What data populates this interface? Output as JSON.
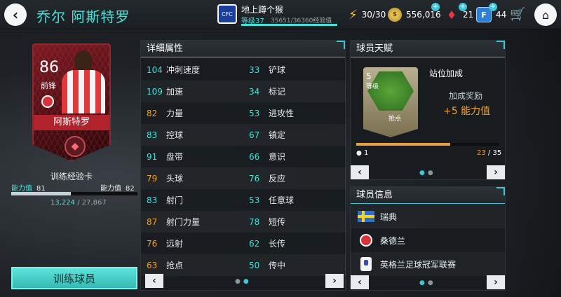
{
  "header": {
    "title": "乔尔 阿斯特罗",
    "team": {
      "name": "地上蹲个猴",
      "level": "等级37",
      "xp": "35651/36360经验值",
      "xp_fraction": 0.98
    },
    "energy": "30/30",
    "coins": "556,016",
    "gems": "21",
    "fifa_points": "44",
    "fifa_points_label": "F"
  },
  "card": {
    "rating": "86",
    "position": "前锋",
    "name": "阿斯特罗",
    "type_label": "训练经验卡",
    "rating_label_left": "能力值",
    "rating_left": "81",
    "rating_label_right": "能力值",
    "rating_right": "82",
    "xp_current": "13,224",
    "xp_total": "/ 27,867",
    "xp_fraction": 0.47
  },
  "train_button": "训练球员",
  "attributes": {
    "title": "详细属性",
    "left": [
      {
        "value": "104",
        "label": "冲刺速度",
        "color": "teal"
      },
      {
        "value": "109",
        "label": "加速",
        "color": "teal"
      },
      {
        "value": "82",
        "label": "力量",
        "color": "orange"
      },
      {
        "value": "83",
        "label": "控球",
        "color": "teal"
      },
      {
        "value": "91",
        "label": "盘带",
        "color": "teal"
      },
      {
        "value": "79",
        "label": "头球",
        "color": "orange"
      },
      {
        "value": "83",
        "label": "射门",
        "color": "teal"
      },
      {
        "value": "87",
        "label": "射门力量",
        "color": "orange"
      },
      {
        "value": "76",
        "label": "远射",
        "color": "orange"
      },
      {
        "value": "63",
        "label": "抢点",
        "color": "orange"
      }
    ],
    "right": [
      {
        "value": "33",
        "label": "铲球",
        "color": "teal"
      },
      {
        "value": "34",
        "label": "标记",
        "color": "teal"
      },
      {
        "value": "53",
        "label": "进攻性",
        "color": "teal"
      },
      {
        "value": "67",
        "label": "镇定",
        "color": "teal"
      },
      {
        "value": "66",
        "label": "意识",
        "color": "teal"
      },
      {
        "value": "76",
        "label": "反应",
        "color": "teal"
      },
      {
        "value": "53",
        "label": "任意球",
        "color": "teal"
      },
      {
        "value": "78",
        "label": "短传",
        "color": "teal"
      },
      {
        "value": "62",
        "label": "长传",
        "color": "teal"
      },
      {
        "value": "50",
        "label": "传中",
        "color": "teal"
      }
    ],
    "prev": "‹",
    "next": "›"
  },
  "talent": {
    "title": "球员天赋",
    "level_num": "5",
    "level_label": "等级",
    "card_type": "抢点",
    "name": "站位加成",
    "bonus_label": "加成奖励",
    "bonus": "+5 能力值",
    "progress_min": "1",
    "progress_current": "23",
    "progress_total": " / 35",
    "progress_fraction": 0.657,
    "prev": "‹",
    "next": "›"
  },
  "info": {
    "title": "球员信息",
    "nation": "瑞典",
    "club": "桑德兰",
    "league": "英格兰足球冠军联赛",
    "prev": "‹",
    "next": "›"
  },
  "colors": {
    "teal": "#48e0d8",
    "orange": "#f0a030",
    "accent": "#41c6d8"
  },
  "icons": {
    "back": "‹",
    "home": "⌂",
    "energy": "⚡",
    "coin": "$",
    "gem": "♦",
    "cart": "🛒",
    "plus": "+",
    "chelsea_crest": "CFC",
    "emblem": "◆",
    "dots": "●●"
  }
}
